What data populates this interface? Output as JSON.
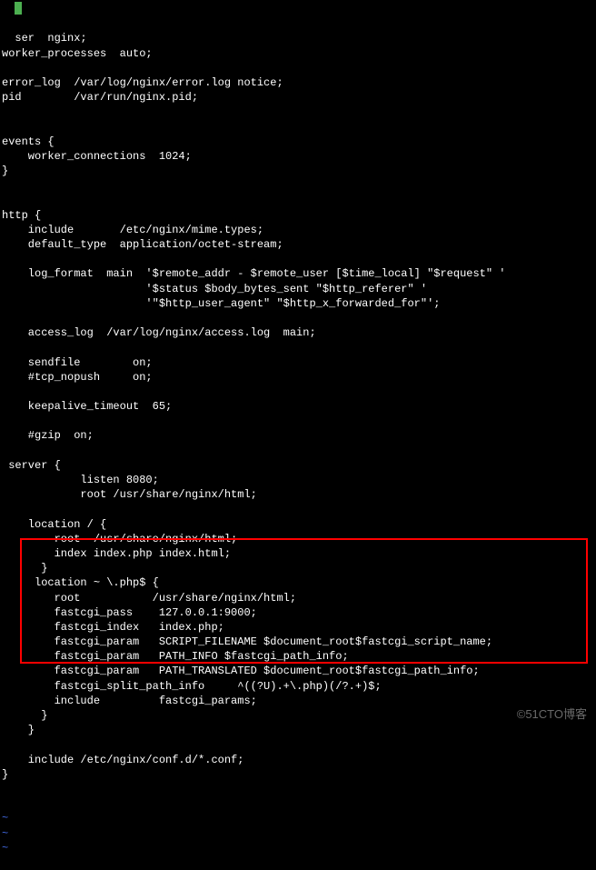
{
  "config": {
    "lines": [
      "  ser  nginx;",
      "worker_processes  auto;",
      "",
      "error_log  /var/log/nginx/error.log notice;",
      "pid        /var/run/nginx.pid;",
      "",
      "",
      "events {",
      "    worker_connections  1024;",
      "}",
      "",
      "",
      "http {",
      "    include       /etc/nginx/mime.types;",
      "    default_type  application/octet-stream;",
      "",
      "    log_format  main  '$remote_addr - $remote_user [$time_local] \"$request\" '",
      "                      '$status $body_bytes_sent \"$http_referer\" '",
      "                      '\"$http_user_agent\" \"$http_x_forwarded_for\"';",
      "",
      "    access_log  /var/log/nginx/access.log  main;",
      "",
      "    sendfile        on;",
      "    #tcp_nopush     on;",
      "",
      "    keepalive_timeout  65;",
      "",
      "    #gzip  on;",
      "",
      " server {",
      "            listen 8080;",
      "            root /usr/share/nginx/html;",
      "",
      "    location / {",
      "        root  /usr/share/nginx/html;",
      "        index index.php index.html;",
      "      }",
      "     location ~ \\.php$ {",
      "        root           /usr/share/nginx/html;",
      "        fastcgi_pass    127.0.0.1:9000;",
      "        fastcgi_index   index.php;",
      "        fastcgi_param   SCRIPT_FILENAME $document_root$fastcgi_script_name;",
      "        fastcgi_param   PATH_INFO $fastcgi_path_info;",
      "        fastcgi_param   PATH_TRANSLATED $document_root$fastcgi_path_info;",
      "        fastcgi_split_path_info     ^((?U).+\\.php)(/?.+)$;",
      "        include         fastcgi_params;",
      "      }",
      "    }",
      "",
      "    include /etc/nginx/conf.d/*.conf;",
      "}"
    ],
    "tildes": [
      "~",
      "~",
      "~"
    ]
  },
  "watermark": "©51CTO博客"
}
